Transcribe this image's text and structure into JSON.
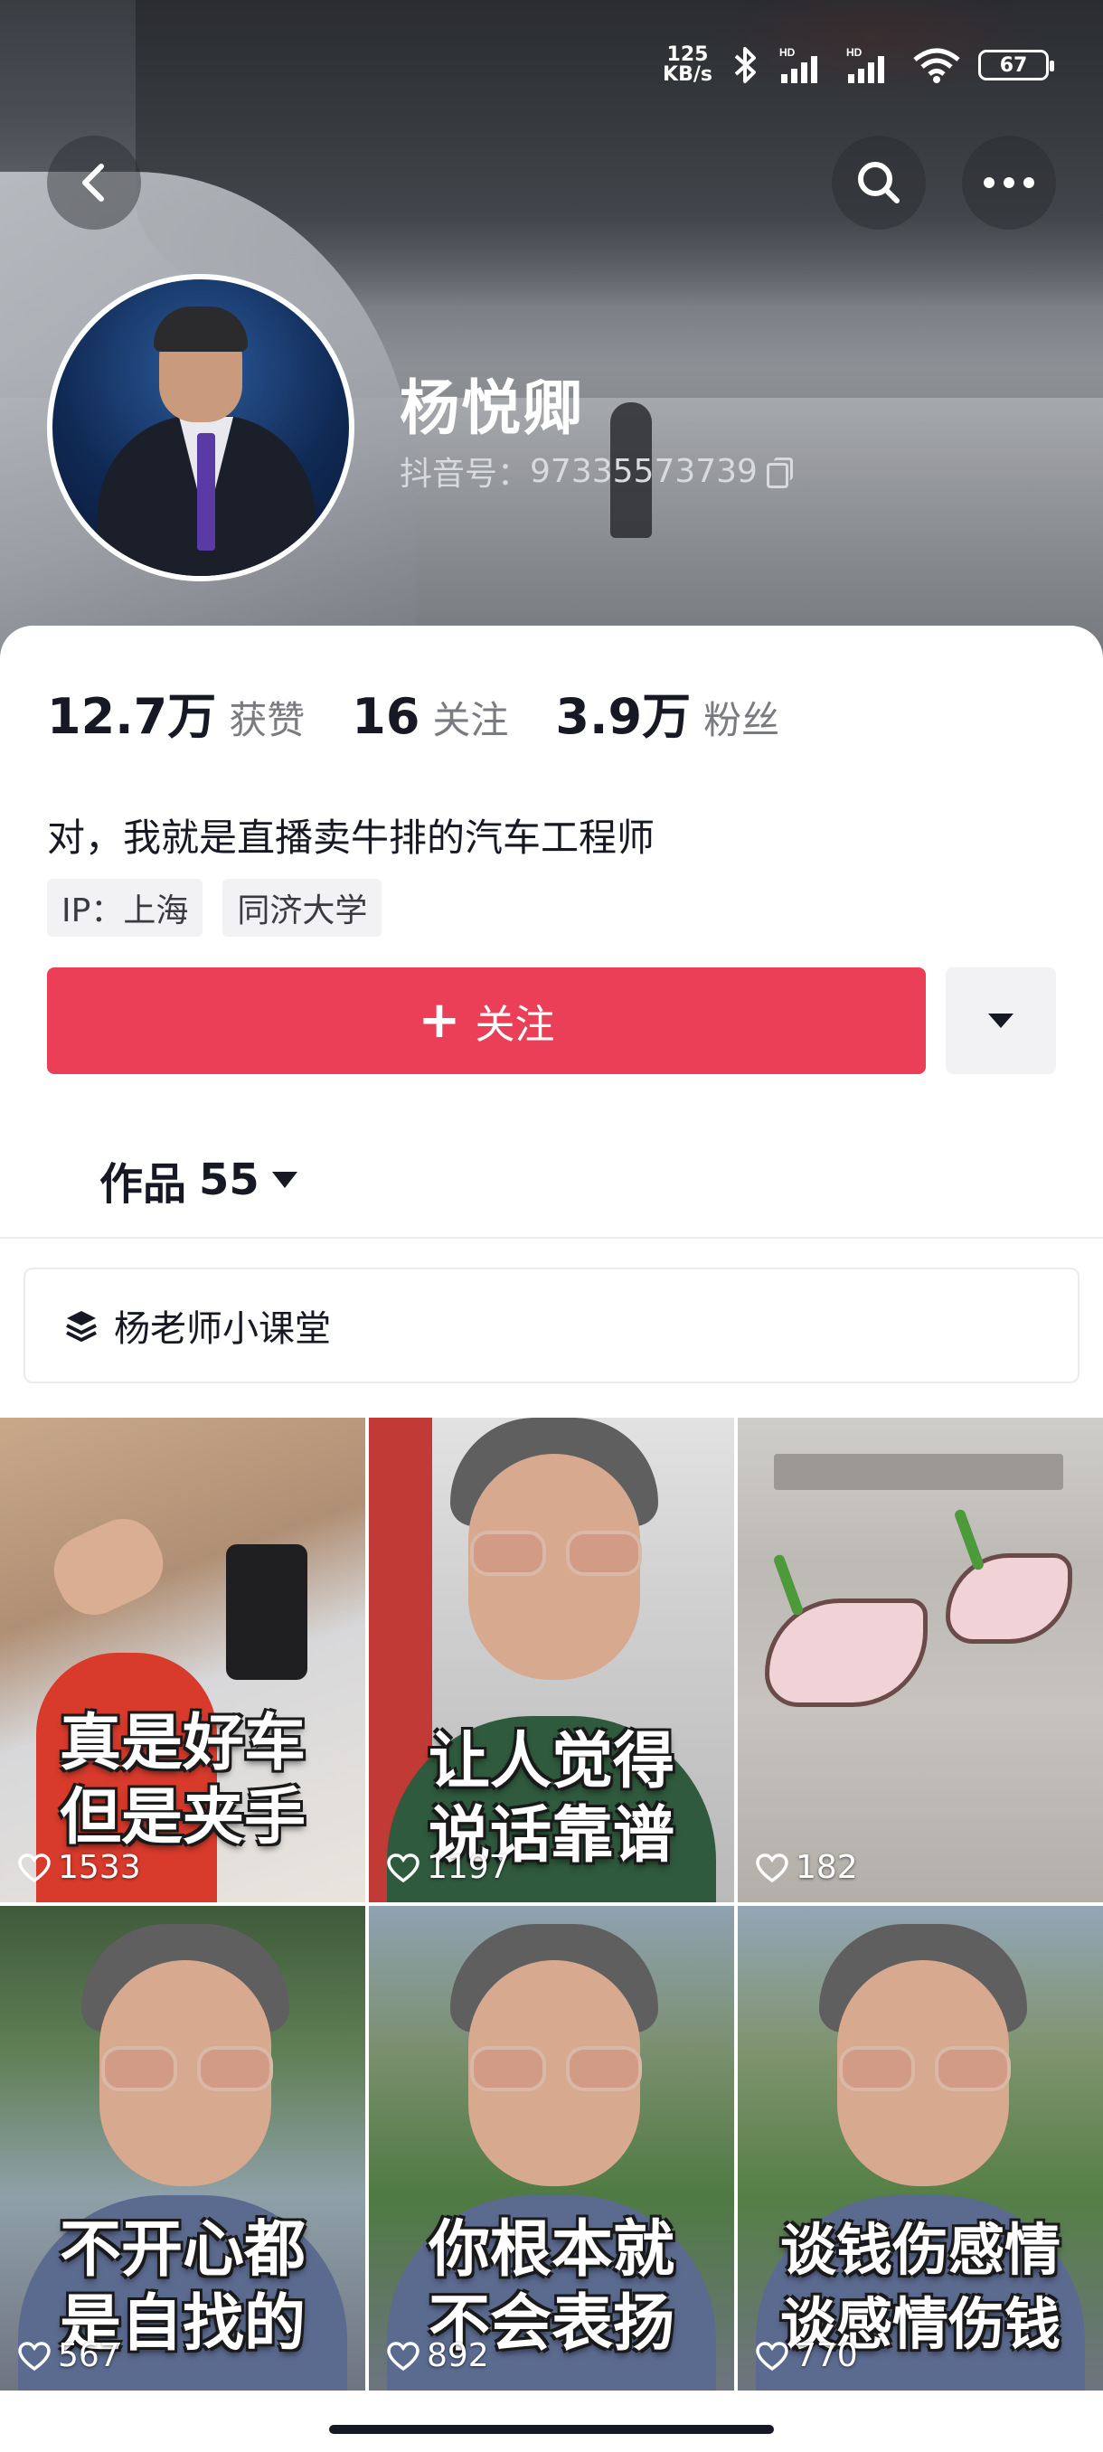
{
  "status_bar": {
    "net_speed_value": "125",
    "net_speed_unit": "KB/s",
    "battery": "67"
  },
  "profile": {
    "name": "杨悦卿",
    "douyin_id_label": "抖音号：",
    "douyin_id": "97335573739",
    "bio": "对，我就是直播卖牛排的汽车工程师",
    "tags": [
      "IP：上海",
      "同济大学"
    ]
  },
  "stats": [
    {
      "value": "12.7万",
      "label": "获赞"
    },
    {
      "value": "16",
      "label": "关注"
    },
    {
      "value": "3.9万",
      "label": "粉丝"
    }
  ],
  "actions": {
    "follow_label": "关注"
  },
  "works_tab": {
    "label": "作品",
    "count": "55"
  },
  "playlist": {
    "title": "杨老师小课堂"
  },
  "videos": [
    {
      "caption_line1": "真是好车",
      "caption_line2": "但是夹手",
      "likes": "1533"
    },
    {
      "caption_line1": "让人觉得",
      "caption_line2": "说话靠谱",
      "likes": "1197"
    },
    {
      "caption_line1": "",
      "caption_line2": "",
      "likes": "182"
    },
    {
      "caption_line1": "不开心都",
      "caption_line2": "是自找的",
      "likes": "567"
    },
    {
      "caption_line1": "你根本就",
      "caption_line2": "不会表扬",
      "likes": "892"
    },
    {
      "caption_line1": "谈钱伤感情",
      "caption_line2": "谈感情伤钱",
      "likes": "770"
    }
  ],
  "colors": {
    "accent": "#ea3f57",
    "text": "#161823",
    "muted": "#7a7b80"
  }
}
